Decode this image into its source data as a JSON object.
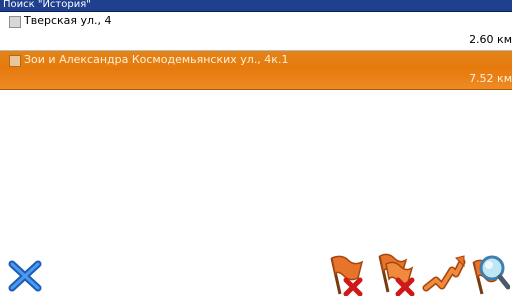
{
  "window": {
    "title": "Поиск \"История\""
  },
  "results": [
    {
      "address": "Тверская ул., 4",
      "distance": "2.60 км",
      "selected": false
    },
    {
      "address": "Зои и Александра Космодемьянских ул., 4к.1",
      "distance": "7.52 км",
      "selected": true
    }
  ],
  "toolbar": {
    "icons": [
      "close-icon",
      "delete-flag-icon",
      "delete-all-flags-icon",
      "route-icon",
      "search-magnifier-icon"
    ]
  },
  "colors": {
    "titlebar": "#1f3f8f",
    "selection": "#e67a0d",
    "close_icon": "#2a6fd0",
    "flag_orange": "#e8742a",
    "delete_red": "#d01818"
  }
}
